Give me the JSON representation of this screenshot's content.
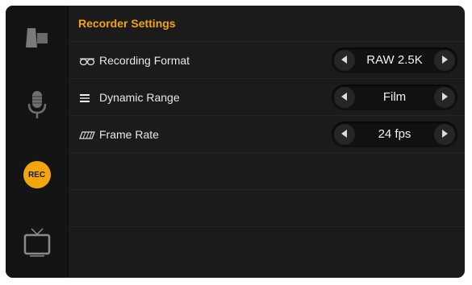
{
  "header": {
    "title": "Recorder Settings"
  },
  "sidebar": {
    "items": [
      {
        "icon": "camera-icon"
      },
      {
        "icon": "microphone-icon"
      },
      {
        "icon": "record-icon",
        "label": "REC",
        "active": true,
        "color": "#f2a50c"
      },
      {
        "icon": "monitor-icon"
      }
    ]
  },
  "settings": {
    "recording_format": {
      "icon": "glasses-icon",
      "label": "Recording Format",
      "value": "RAW 2.5K"
    },
    "dynamic_range": {
      "icon": "dynamic-range-icon",
      "label": "Dynamic Range",
      "value": "Film"
    },
    "frame_rate": {
      "icon": "film-strip-icon",
      "label": "Frame Rate",
      "value": "24 fps"
    }
  },
  "colors": {
    "accent": "#f2a50c",
    "background": "#1b1b1b",
    "text": "#e8e8e8"
  }
}
